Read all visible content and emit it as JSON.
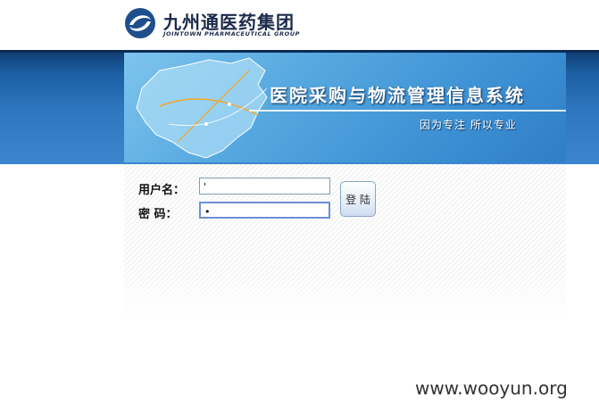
{
  "header": {
    "logo_cn": "九州通医药集团",
    "logo_en": "JOINTOWN PHARMACEUTICAL GROUP"
  },
  "banner": {
    "title": "医院采购与物流管理信息系统",
    "slogan": "因为专注  所以专业"
  },
  "login": {
    "username_label": "用户名：",
    "password_label": "密  码：",
    "username_value": "'",
    "password_value": "•",
    "button_label": "登 陆"
  },
  "watermark": "www.wooyun.org",
  "colors": {
    "brand_blue": "#1c5fa3",
    "banner_light": "#7ec4ee"
  }
}
